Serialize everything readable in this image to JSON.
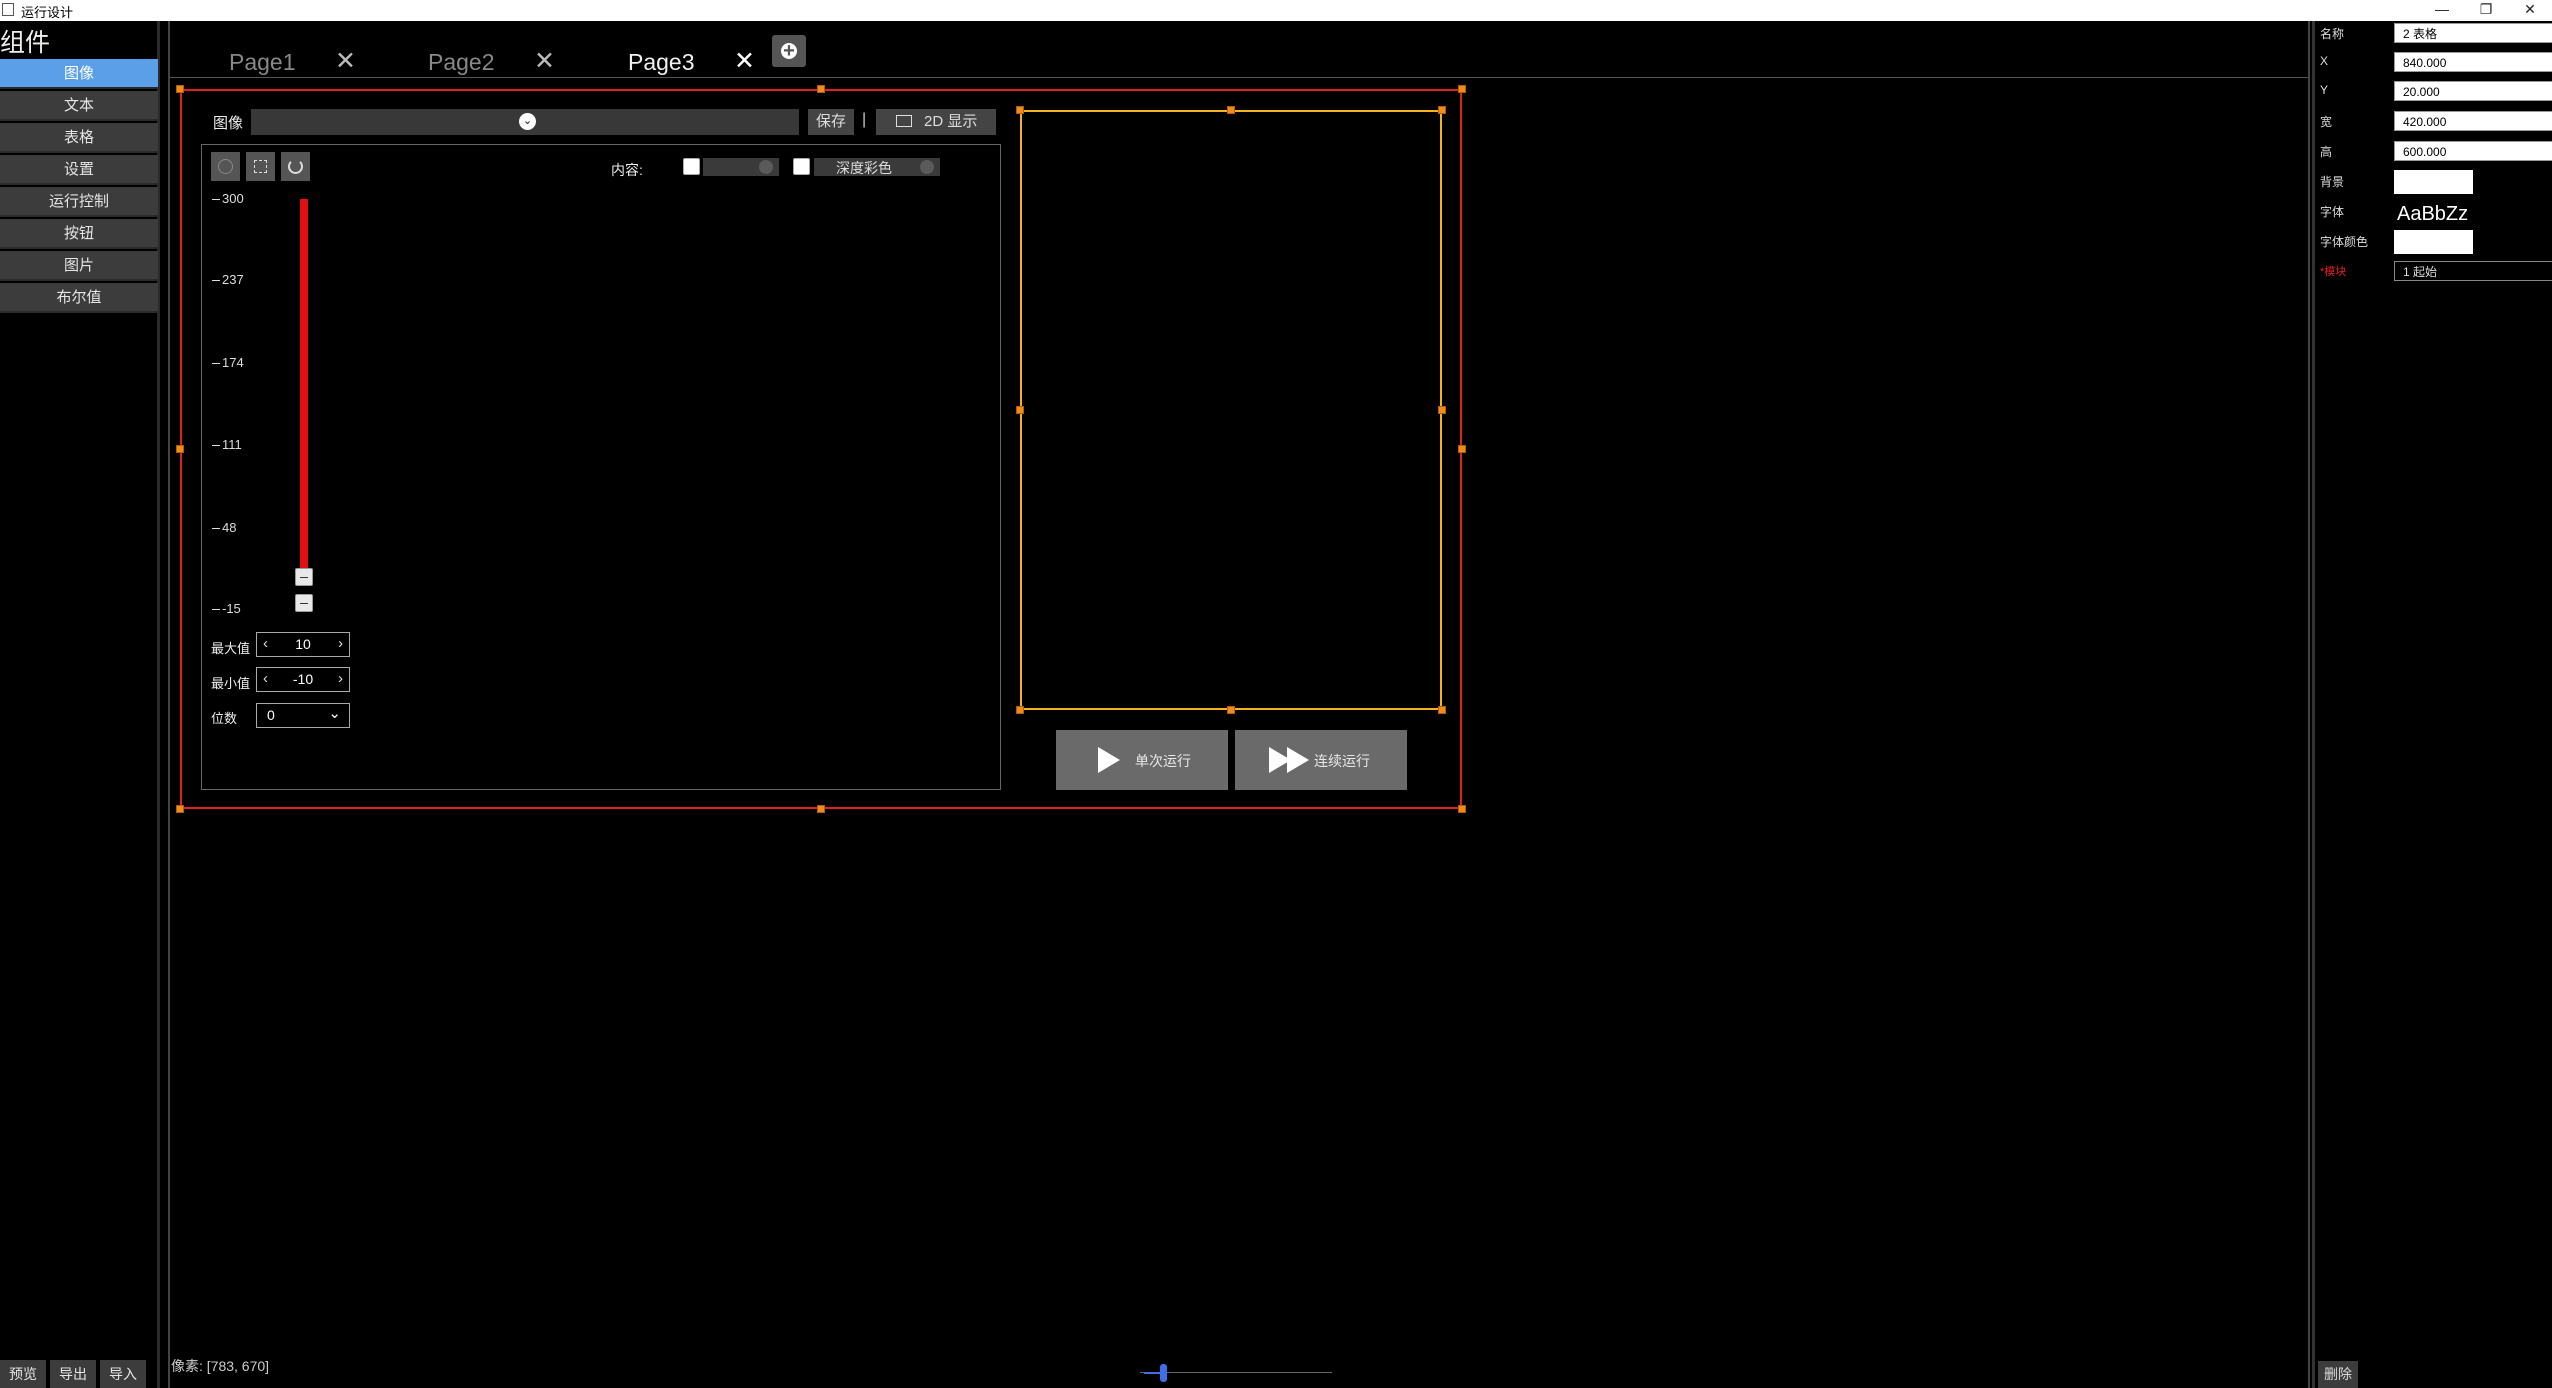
{
  "window": {
    "title": "运行设计",
    "min": "—",
    "restore": "❐",
    "close": "✕"
  },
  "left_panel": {
    "title": "组件",
    "items": [
      "图像",
      "文本",
      "表格",
      "设置",
      "运行控制",
      "按钮",
      "图片",
      "布尔值"
    ],
    "selected_index": 0,
    "bottom_buttons": [
      "预览",
      "导出",
      "导入"
    ]
  },
  "tabs": [
    {
      "label": "Page1",
      "close": "✕",
      "active": false
    },
    {
      "label": "Page2",
      "close": "✕",
      "active": false
    },
    {
      "label": "Page3",
      "close": "✕",
      "active": true
    }
  ],
  "add_tab_icon": "plus-circle-icon",
  "image_control": {
    "label": "图像",
    "combo_value": "",
    "save_label": "保存",
    "separator": "|",
    "display_label": "2D 显示",
    "content_label": "内容:",
    "content_combo1": "",
    "content_combo2": "深度彩色",
    "colorbar_ticks": [
      "300",
      "237",
      "174",
      "111",
      "48",
      "-15"
    ],
    "colorbar_color": "#e01010",
    "max_label": "最大值",
    "max_value": "10",
    "min_label": "最小值",
    "min_value": "-10",
    "digits_label": "位数",
    "digits_value": "0"
  },
  "run_buttons": {
    "single": "单次运行",
    "continuous": "连续运行"
  },
  "status": {
    "pixel_readout": "像素: [783, 670]"
  },
  "properties": {
    "rows": [
      {
        "label": "名称",
        "value": "2 表格"
      },
      {
        "label": "X",
        "value": "840.000"
      },
      {
        "label": "Y",
        "value": "20.000"
      },
      {
        "label": "宽",
        "value": "420.000"
      },
      {
        "label": "高",
        "value": "600.000"
      }
    ],
    "background_label": "背景",
    "font_label": "字体",
    "font_sample": "AaBbZz",
    "font_color_label": "字体颜色",
    "binding_label": "*模块",
    "binding_value": "1 起始",
    "delete_label": "删除"
  },
  "colors": {
    "accent": "#5b9fe8",
    "selection_red": "#e02020",
    "selection_yellow": "#f3b51f",
    "handle": "#f08b1e"
  }
}
